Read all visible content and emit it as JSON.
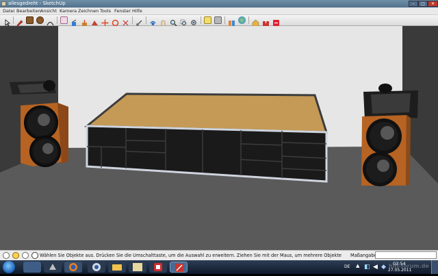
{
  "window": {
    "title": "allesgedreht - SketchUp",
    "min_label": "–",
    "max_label": "□",
    "close_label": "✕"
  },
  "menu": {
    "items": [
      "Datei",
      "Bearbeiten",
      "Ansicht",
      "Kamera",
      "Zeichnen",
      "Tools",
      "Fenster",
      "Hilfe"
    ]
  },
  "toolbar": {
    "tools": [
      "select-arrow",
      "pencil",
      "rectangle",
      "circle",
      "arc",
      "eraser",
      "paint-bucket",
      "push-pull",
      "move",
      "rotate",
      "follow-me",
      "orbit",
      "pan",
      "zoom",
      "zoom-extents",
      "components",
      "materials",
      "scenes",
      "globe",
      "3d-warehouse",
      "export"
    ]
  },
  "statusbar": {
    "hint": "Wählen Sie Objekte aus. Drücken Sie die Umschalttaste, um die Auswahl zu erweitern. Ziehen Sie mit der Maus, um mehrere Objekte",
    "measurement_label": "Maßangaben",
    "measurement_value": ""
  },
  "taskbar": {
    "apps": [
      "windows-explorer",
      "winamp",
      "firefox",
      "teamspeak",
      "file-explorer",
      "tyc",
      "acrobat",
      "sketchup"
    ],
    "language": "DE",
    "time": "03:54",
    "date": "27.05.2011",
    "watermark": "hifi-forum.de"
  },
  "colors": {
    "title_bar": "#5a7996",
    "wall": "#e6e6e6",
    "floor": "#555555",
    "tabletop": "#c59a56",
    "speaker_wood": "#b36020",
    "taskbar": "#1a2840"
  }
}
